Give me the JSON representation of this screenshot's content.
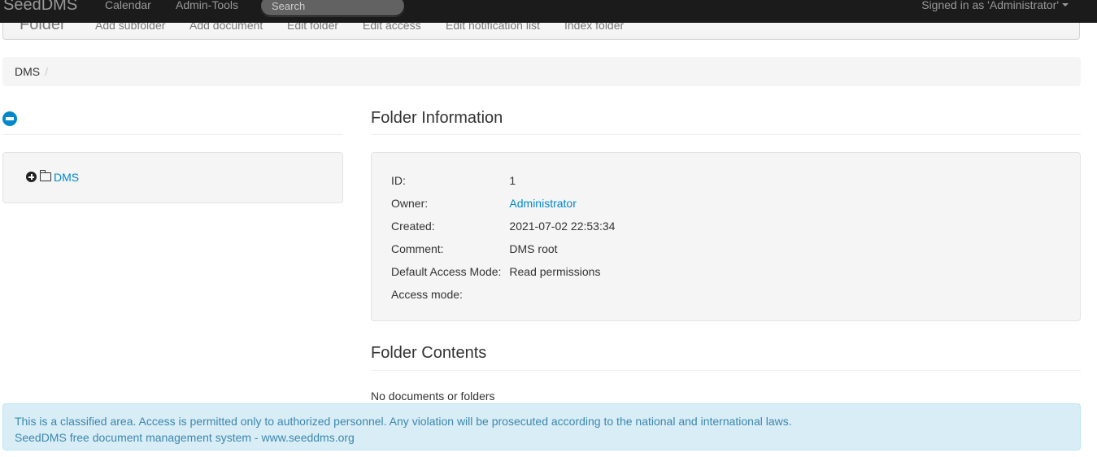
{
  "navbar": {
    "brand": "SeedDMS",
    "links": [
      "Calendar",
      "Admin-Tools"
    ],
    "search_placeholder": "Search",
    "signed_in": "Signed in as 'Administrator'"
  },
  "subnav": {
    "title": "Folder",
    "actions": [
      "Add subfolder",
      "Add document",
      "Edit folder",
      "Edit access",
      "Edit notification list",
      "Index folder"
    ]
  },
  "breadcrumb": {
    "items": [
      "DMS"
    ],
    "divider": "/"
  },
  "tree": {
    "root_label": "DMS"
  },
  "folder_info": {
    "title": "Folder Information",
    "rows": [
      {
        "label": "ID:",
        "value": "1"
      },
      {
        "label": "Owner:",
        "value": "Administrator"
      },
      {
        "label": "Created:",
        "value": "2021-07-02 22:53:34"
      },
      {
        "label": "Comment:",
        "value": "DMS root"
      },
      {
        "label": "Default Access Mode:",
        "value": "Read permissions"
      },
      {
        "label": "Access mode:",
        "value": ""
      }
    ]
  },
  "folder_contents": {
    "title": "Folder Contents",
    "empty_text": "No documents or folders"
  },
  "footer": {
    "disclaimer": "This is a classified area. Access is permitted only to authorized personnel. Any violation will be prosecuted according to the national and international laws.",
    "credit": "SeedDMS free document management system - www.seeddms.org"
  },
  "colors": {
    "navbar_bg": "#1b1b1b",
    "link": "#0088cc",
    "alert_bg": "#d9edf7",
    "alert_text": "#3a87ad",
    "well_bg": "#f5f5f5"
  },
  "icons": [
    "caret-down-icon",
    "minus-circle-icon",
    "plus-circle-icon",
    "folder-icon"
  ]
}
